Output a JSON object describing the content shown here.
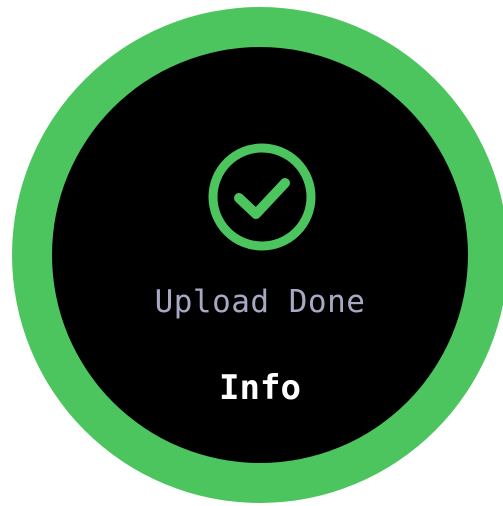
{
  "colors": {
    "accent": "#4cc55f",
    "background": "#000000",
    "status_text": "#a7a9c4",
    "button_text": "#ffffff"
  },
  "icon": "check-circle-icon",
  "status": {
    "label": "Upload Done"
  },
  "actions": {
    "info_label": "Info"
  }
}
